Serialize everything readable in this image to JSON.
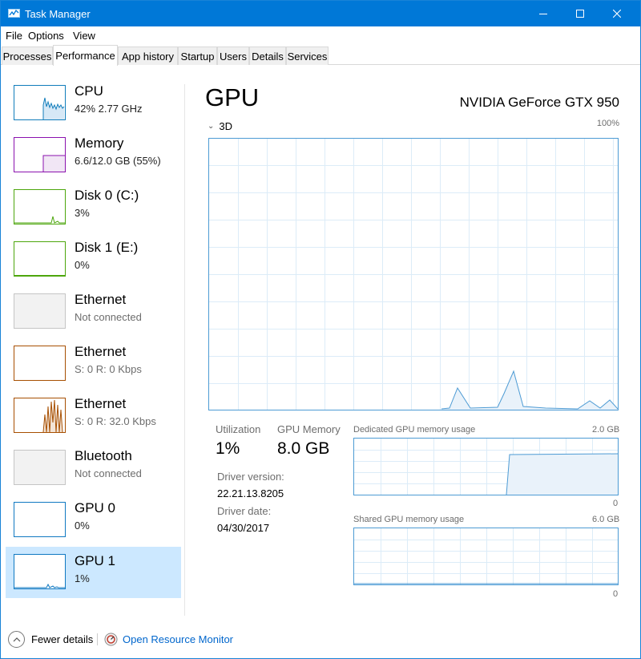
{
  "window": {
    "title": "Task Manager"
  },
  "menu": [
    "File",
    "Options",
    "View"
  ],
  "tabs": [
    "Processes",
    "Performance",
    "App history",
    "Startup",
    "Users",
    "Details",
    "Services"
  ],
  "devices": [
    {
      "name": "CPU",
      "sub": "42%  2.77 GHz",
      "color": "#117dbb"
    },
    {
      "name": "Memory",
      "sub": "6.6/12.0 GB (55%)",
      "color": "#8b12ae"
    },
    {
      "name": "Disk 0 (C:)",
      "sub": "3%",
      "color": "#4da60c"
    },
    {
      "name": "Disk 1 (E:)",
      "sub": "0%",
      "color": "#4da60c"
    },
    {
      "name": "Ethernet",
      "sub": "Not connected",
      "color": "#b8b8b8"
    },
    {
      "name": "Ethernet",
      "sub": "S: 0  R: 0 Kbps",
      "color": "#a74f01"
    },
    {
      "name": "Ethernet",
      "sub": "S: 0  R: 32.0 Kbps",
      "color": "#a74f01"
    },
    {
      "name": "Bluetooth",
      "sub": "Not connected",
      "color": "#b8b8b8"
    },
    {
      "name": "GPU 0",
      "sub": "0%",
      "color": "#1079c2"
    },
    {
      "name": "GPU 1",
      "sub": "1%",
      "color": "#1079c2"
    }
  ],
  "gpu": {
    "title": "GPU",
    "model": "NVIDIA GeForce GTX 950",
    "engine": "3D",
    "max_label": "100%",
    "utilization_label": "Utilization",
    "utilization_value": "1%",
    "memory_label": "GPU Memory",
    "memory_value": "8.0 GB",
    "driver_version_label": "Driver version:",
    "driver_version_value": "22.21.13.8205",
    "driver_date_label": "Driver date:",
    "driver_date_value": "04/30/2017",
    "dedicated_label": "Dedicated GPU memory usage",
    "dedicated_max": "2.0 GB",
    "dedicated_min": "0",
    "shared_label": "Shared GPU memory usage",
    "shared_max": "6.0 GB",
    "shared_min": "0"
  },
  "bottom": {
    "fewer_details": "Fewer details",
    "open_resource_monitor": "Open Resource Monitor"
  }
}
